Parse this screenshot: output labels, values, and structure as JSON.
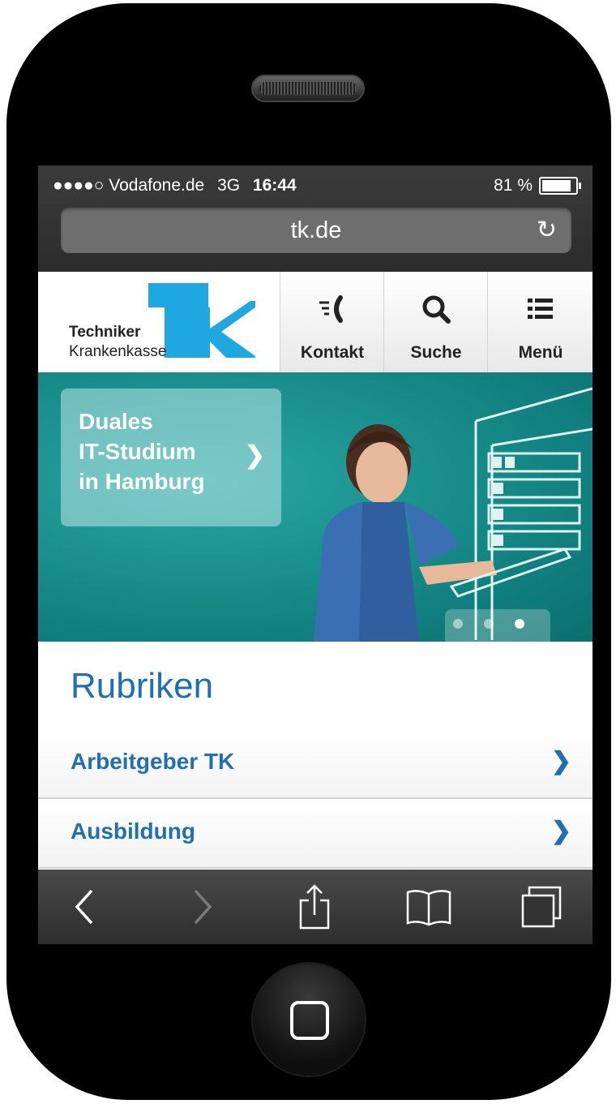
{
  "status_bar": {
    "signal": "●●●●○",
    "carrier": "Vodafone.de",
    "network": "3G",
    "time": "16:44",
    "battery": "81 %",
    "battery_level": 0.81
  },
  "browser": {
    "url": "tk.de",
    "reload_icon": "reload-icon"
  },
  "logo": {
    "line1": "Techniker",
    "line2": "Krankenkasse",
    "brand_color": "#1ea7e1"
  },
  "nav": {
    "kontakt": "Kontakt",
    "suche": "Suche",
    "menu": "Menü"
  },
  "hero": {
    "line1": "Duales",
    "line2": "IT-Studium",
    "line3": "in Hamburg",
    "dots_active": 3
  },
  "content": {
    "section_title": "Rubriken",
    "items": [
      {
        "label": "Arbeitgeber TK"
      },
      {
        "label": "Ausbildung"
      }
    ]
  },
  "colors": {
    "accent": "#1f6fb2",
    "hero_teal": "#13908d"
  }
}
